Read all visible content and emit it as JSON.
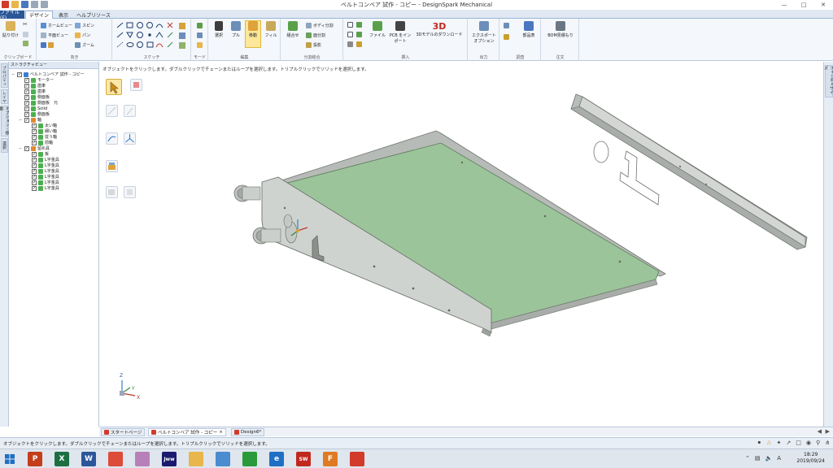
{
  "window": {
    "title": "ベルトコンベア 試作 - コピー - DesignSpark Mechanical"
  },
  "tabs": {
    "file": "ファイル(F)",
    "design": "デザイン",
    "view": "表示",
    "help": "ヘルプリソース"
  },
  "ribbon": {
    "clipboard": {
      "paste": "貼り付け",
      "label": "クリップボード"
    },
    "orient": {
      "home_view": "ホームビュー",
      "plane_view": "平面ビュー",
      "spin": "スピン",
      "pan": "パン",
      "zoom": "ズーム",
      "label": "向き"
    },
    "sketch": {
      "label": "スケッチ"
    },
    "mode": {
      "label": "モード"
    },
    "edit": {
      "select": "選択",
      "pull": "プル",
      "move": "移動",
      "fill": "フィル",
      "label": "編集"
    },
    "intersect": {
      "combine": "組合せ",
      "split_body": "ボディ分割",
      "split_face": "面分割",
      "project": "投影",
      "label": "分割結合"
    },
    "insert": {
      "file": "ファイル",
      "pcb": "PCB をインポート",
      "model3d": "3Dモデルのダウンロード",
      "model3d_icon_text": "3D",
      "label": "挿入"
    },
    "output": {
      "export": "エクスポートオプション",
      "label": "出力"
    },
    "investigate": {
      "parts": "部品表",
      "label": "調査"
    },
    "order": {
      "bom": "BOM見積もり",
      "label": "注文"
    }
  },
  "left_strip": {
    "properties": "プロパティ",
    "layers": "レイヤ",
    "options": "オプション - 移動",
    "select": "選択"
  },
  "structure": {
    "header": "ストラクチャビュー",
    "items": [
      {
        "label": "ベルトコンベア 試作 - コピー",
        "level": 0,
        "exp": "−",
        "color": "#3a7fcf"
      },
      {
        "label": "モーター",
        "level": 1,
        "exp": "",
        "color": "#4caf50"
      },
      {
        "label": "歯車",
        "level": 1,
        "exp": "",
        "color": "#4caf50"
      },
      {
        "label": "歯車",
        "level": 1,
        "exp": "",
        "color": "#4caf50"
      },
      {
        "label": "側面板",
        "level": 1,
        "exp": "",
        "color": "#4caf50"
      },
      {
        "label": "側面板　元",
        "level": 1,
        "exp": "",
        "color": "#4caf50"
      },
      {
        "label": "Solid",
        "level": 1,
        "exp": "",
        "color": "#4caf50"
      },
      {
        "label": "側面板",
        "level": 1,
        "exp": "",
        "color": "#4caf50"
      },
      {
        "label": "軸",
        "level": 1,
        "exp": "−",
        "color": "#e08a2e"
      },
      {
        "label": "太い軸",
        "level": 2,
        "exp": "",
        "color": "#4caf50"
      },
      {
        "label": "細い軸",
        "level": 2,
        "exp": "",
        "color": "#4caf50"
      },
      {
        "label": "従う軸",
        "level": 2,
        "exp": "",
        "color": "#4caf50"
      },
      {
        "label": "前軸",
        "level": 2,
        "exp": "",
        "color": "#4caf50"
      },
      {
        "label": "留め具",
        "level": 1,
        "exp": "−",
        "color": "#e08a2e"
      },
      {
        "label": "板",
        "level": 2,
        "exp": "",
        "color": "#4caf50"
      },
      {
        "label": "L字金具",
        "level": 2,
        "exp": "",
        "color": "#4caf50"
      },
      {
        "label": "L字金具",
        "level": 2,
        "exp": "",
        "color": "#4caf50"
      },
      {
        "label": "L字金具",
        "level": 2,
        "exp": "",
        "color": "#4caf50"
      },
      {
        "label": "L字金具",
        "level": 2,
        "exp": "",
        "color": "#4caf50"
      },
      {
        "label": "L字金具",
        "level": 2,
        "exp": "",
        "color": "#4caf50"
      },
      {
        "label": "L字金具",
        "level": 2,
        "exp": "",
        "color": "#4caf50"
      }
    ]
  },
  "viewport": {
    "hint": "オブジェクトをクリックします。ダブルクリックでチェーンまたはループを選択します。トリプルクリックでソリッドを選択します。",
    "axis_labels": {
      "x": "X",
      "y": "Y",
      "z": "Z"
    }
  },
  "right_strip": {
    "tab": "フィーチャサイズ"
  },
  "doc_tabs": [
    {
      "label": "スタートページ",
      "active": false,
      "close": ""
    },
    {
      "label": "ベルトコンベア 試作 - コピー",
      "active": true,
      "close": "×"
    },
    {
      "label": "Design6*",
      "active": false,
      "close": ""
    }
  ],
  "statusbar": {
    "message": "オブジェクトをクリックします。ダブルクリックでチェーンまたはループを選択します。トリプルクリックでソリッドを選択します。"
  },
  "taskbar": {
    "time": "18:29",
    "date": "2019/09/24",
    "apps": [
      {
        "name": "powerpoint",
        "text": "P",
        "color": "#c43e1c"
      },
      {
        "name": "excel",
        "text": "X",
        "color": "#1d6f42"
      },
      {
        "name": "word",
        "text": "W",
        "color": "#2b579a"
      },
      {
        "name": "chrome",
        "text": "",
        "color": "#dd4b39"
      },
      {
        "name": "app-pink",
        "text": "",
        "color": "#b880b8"
      },
      {
        "name": "jw-cad",
        "text": "Jww",
        "color": "#1a1a6e"
      },
      {
        "name": "explorer",
        "text": "",
        "color": "#e8b64c"
      },
      {
        "name": "app-blue",
        "text": "",
        "color": "#4a8ccf"
      },
      {
        "name": "store",
        "text": "",
        "color": "#2a9a3a"
      },
      {
        "name": "edge",
        "text": "e",
        "color": "#1f6fc4"
      },
      {
        "name": "solidworks",
        "text": "SW",
        "color": "#c0281e"
      },
      {
        "name": "app-orange",
        "text": "F",
        "color": "#e07a22"
      },
      {
        "name": "designspark",
        "text": "",
        "color": "#d23a2a"
      }
    ]
  },
  "colors": {
    "plate": "#cfd3cf",
    "plate_edge": "#7a7f7a",
    "belt": "#9cc49a",
    "accent": "#2b5797"
  }
}
